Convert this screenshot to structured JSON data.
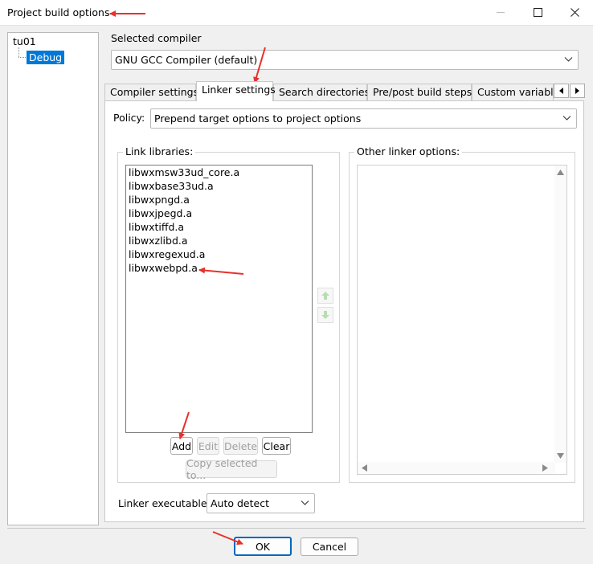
{
  "window": {
    "title": "Project build options"
  },
  "tree": {
    "root": "tu01",
    "child": "Debug"
  },
  "compiler": {
    "label": "Selected compiler",
    "value": "GNU GCC Compiler (default)"
  },
  "tabs": [
    {
      "label": "Compiler settings"
    },
    {
      "label": "Linker settings"
    },
    {
      "label": "Search directories"
    },
    {
      "label": "Pre/post build steps"
    },
    {
      "label": "Custom variable"
    }
  ],
  "policy": {
    "label": "Policy:",
    "value": "Prepend target options to project options"
  },
  "link_libraries": {
    "title": "Link libraries:",
    "items": [
      "libwxmsw33ud_core.a",
      "libwxbase33ud.a",
      "libwxpngd.a",
      "libwxjpegd.a",
      "libwxtiffd.a",
      "libwxzlibd.a",
      "libwxregexud.a",
      "libwxwebpd.a"
    ],
    "buttons": {
      "add": "Add",
      "edit": "Edit",
      "delete": "Delete",
      "clear": "Clear",
      "copy": "Copy selected to..."
    }
  },
  "other_linker": {
    "title": "Other linker options:"
  },
  "linker_exe": {
    "label": "Linker executable:",
    "value": "Auto detect"
  },
  "footer": {
    "ok": "OK",
    "cancel": "Cancel"
  },
  "colors": {
    "selection": "#0078d7",
    "annotation_arrow": "#e8302a",
    "default_button_border": "#0067c0"
  }
}
